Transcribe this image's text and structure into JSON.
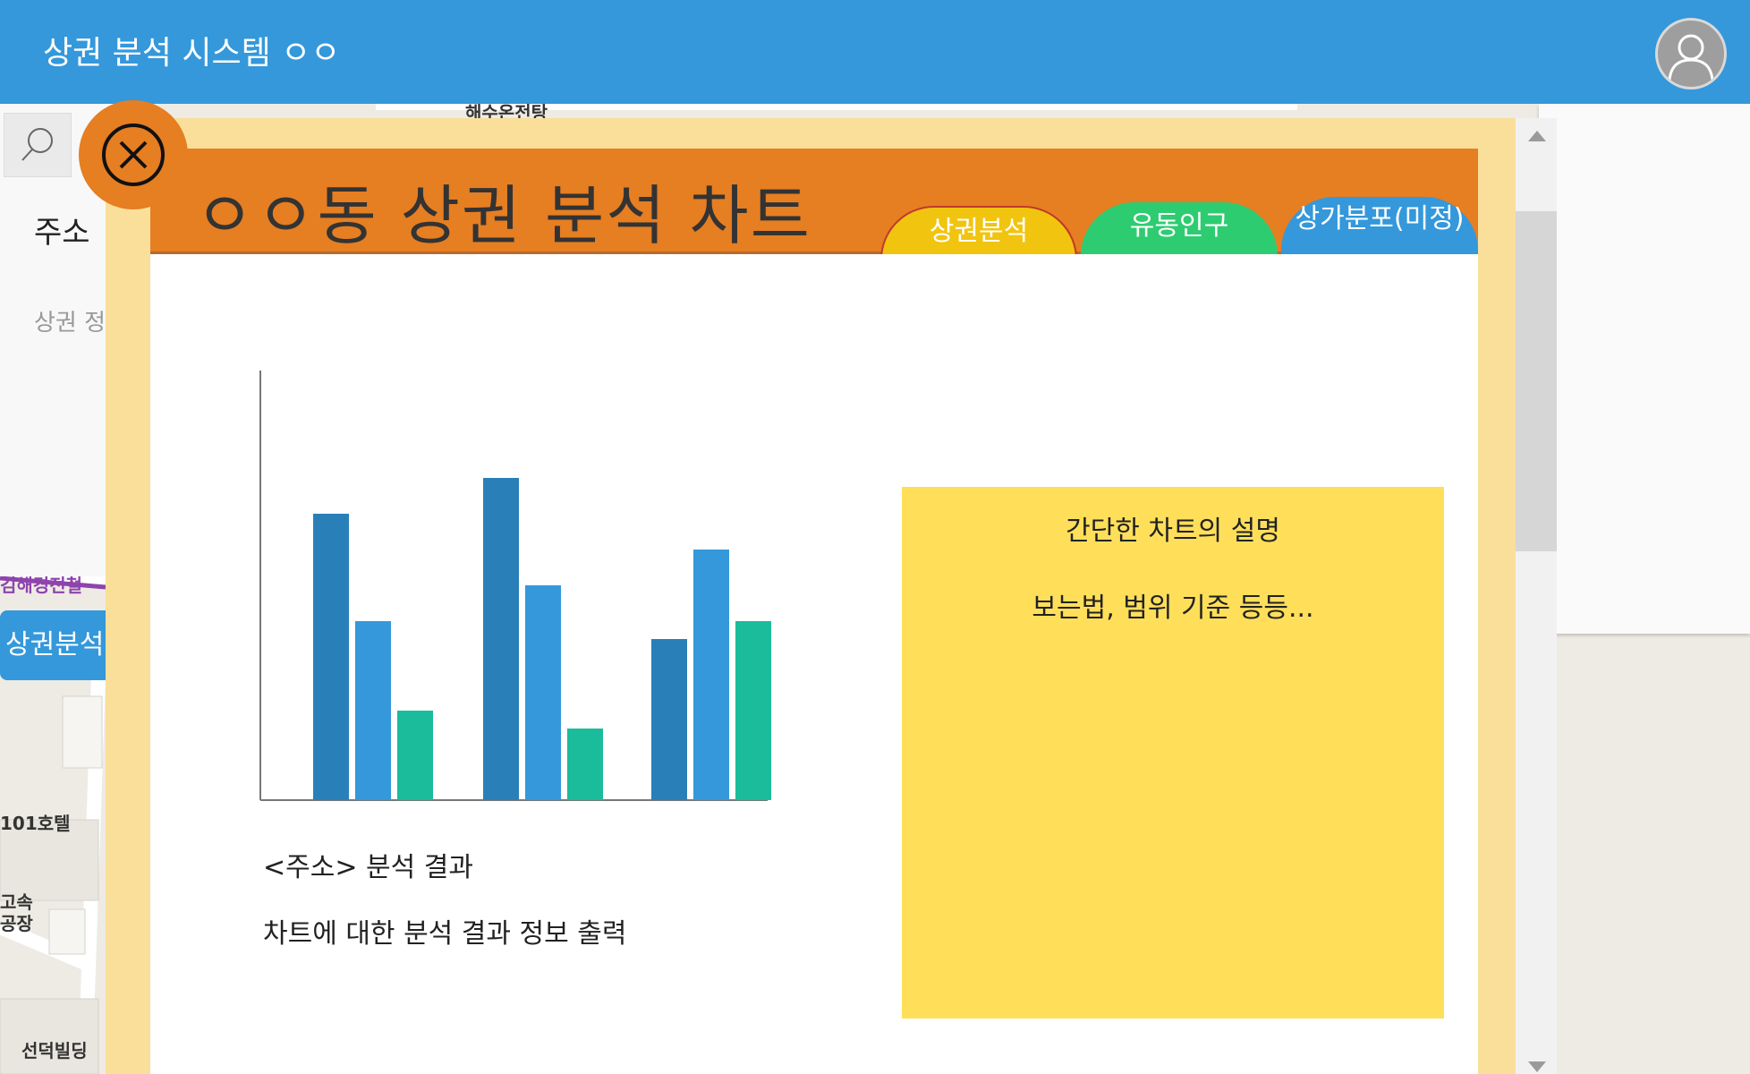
{
  "app": {
    "title": "상권 분석 시스템 ㅇㅇ"
  },
  "left_panel": {
    "address_label": "주소",
    "info_label": "상권 정",
    "analyze_button": "상권분석"
  },
  "map_labels": [
    "해수온전탕",
    "김해경전철",
    "101호텔",
    "고속",
    "공장",
    "선덕빌딩"
  ],
  "modal": {
    "title": "ㅇㅇ동 상권 분석 차트",
    "tabs": [
      {
        "label": "상권분석",
        "color": "#f1c40f"
      },
      {
        "label": "유동인구",
        "color": "#2ecc71"
      },
      {
        "label": "상가분포(미정)",
        "color": "#3498db"
      }
    ],
    "result_title": "<주소> 분석 결과",
    "result_desc": "차트에 대한 분석 결과 정보 출력",
    "description": {
      "line1": "간단한 차트의 설명",
      "line2": "보는법, 범위 기준 등등..."
    }
  },
  "colors": {
    "topbar": "#3498db",
    "modal_frame": "#f9df9a",
    "modal_header": "#e67e22",
    "description_box": "#ffdf5a"
  },
  "icons": {
    "search": "search-icon",
    "user": "user-icon",
    "close": "close-icon"
  },
  "chart_data": {
    "type": "bar",
    "categories": [
      "",
      "",
      ""
    ],
    "series": [
      {
        "color": "#2980b9",
        "values": [
          80,
          90,
          45
        ]
      },
      {
        "color": "#3498db",
        "values": [
          50,
          60,
          70
        ]
      },
      {
        "color": "#1abc9c",
        "values": [
          25,
          20,
          50
        ]
      }
    ],
    "ylim": [
      0,
      120
    ],
    "grid": false,
    "legend": "none"
  }
}
